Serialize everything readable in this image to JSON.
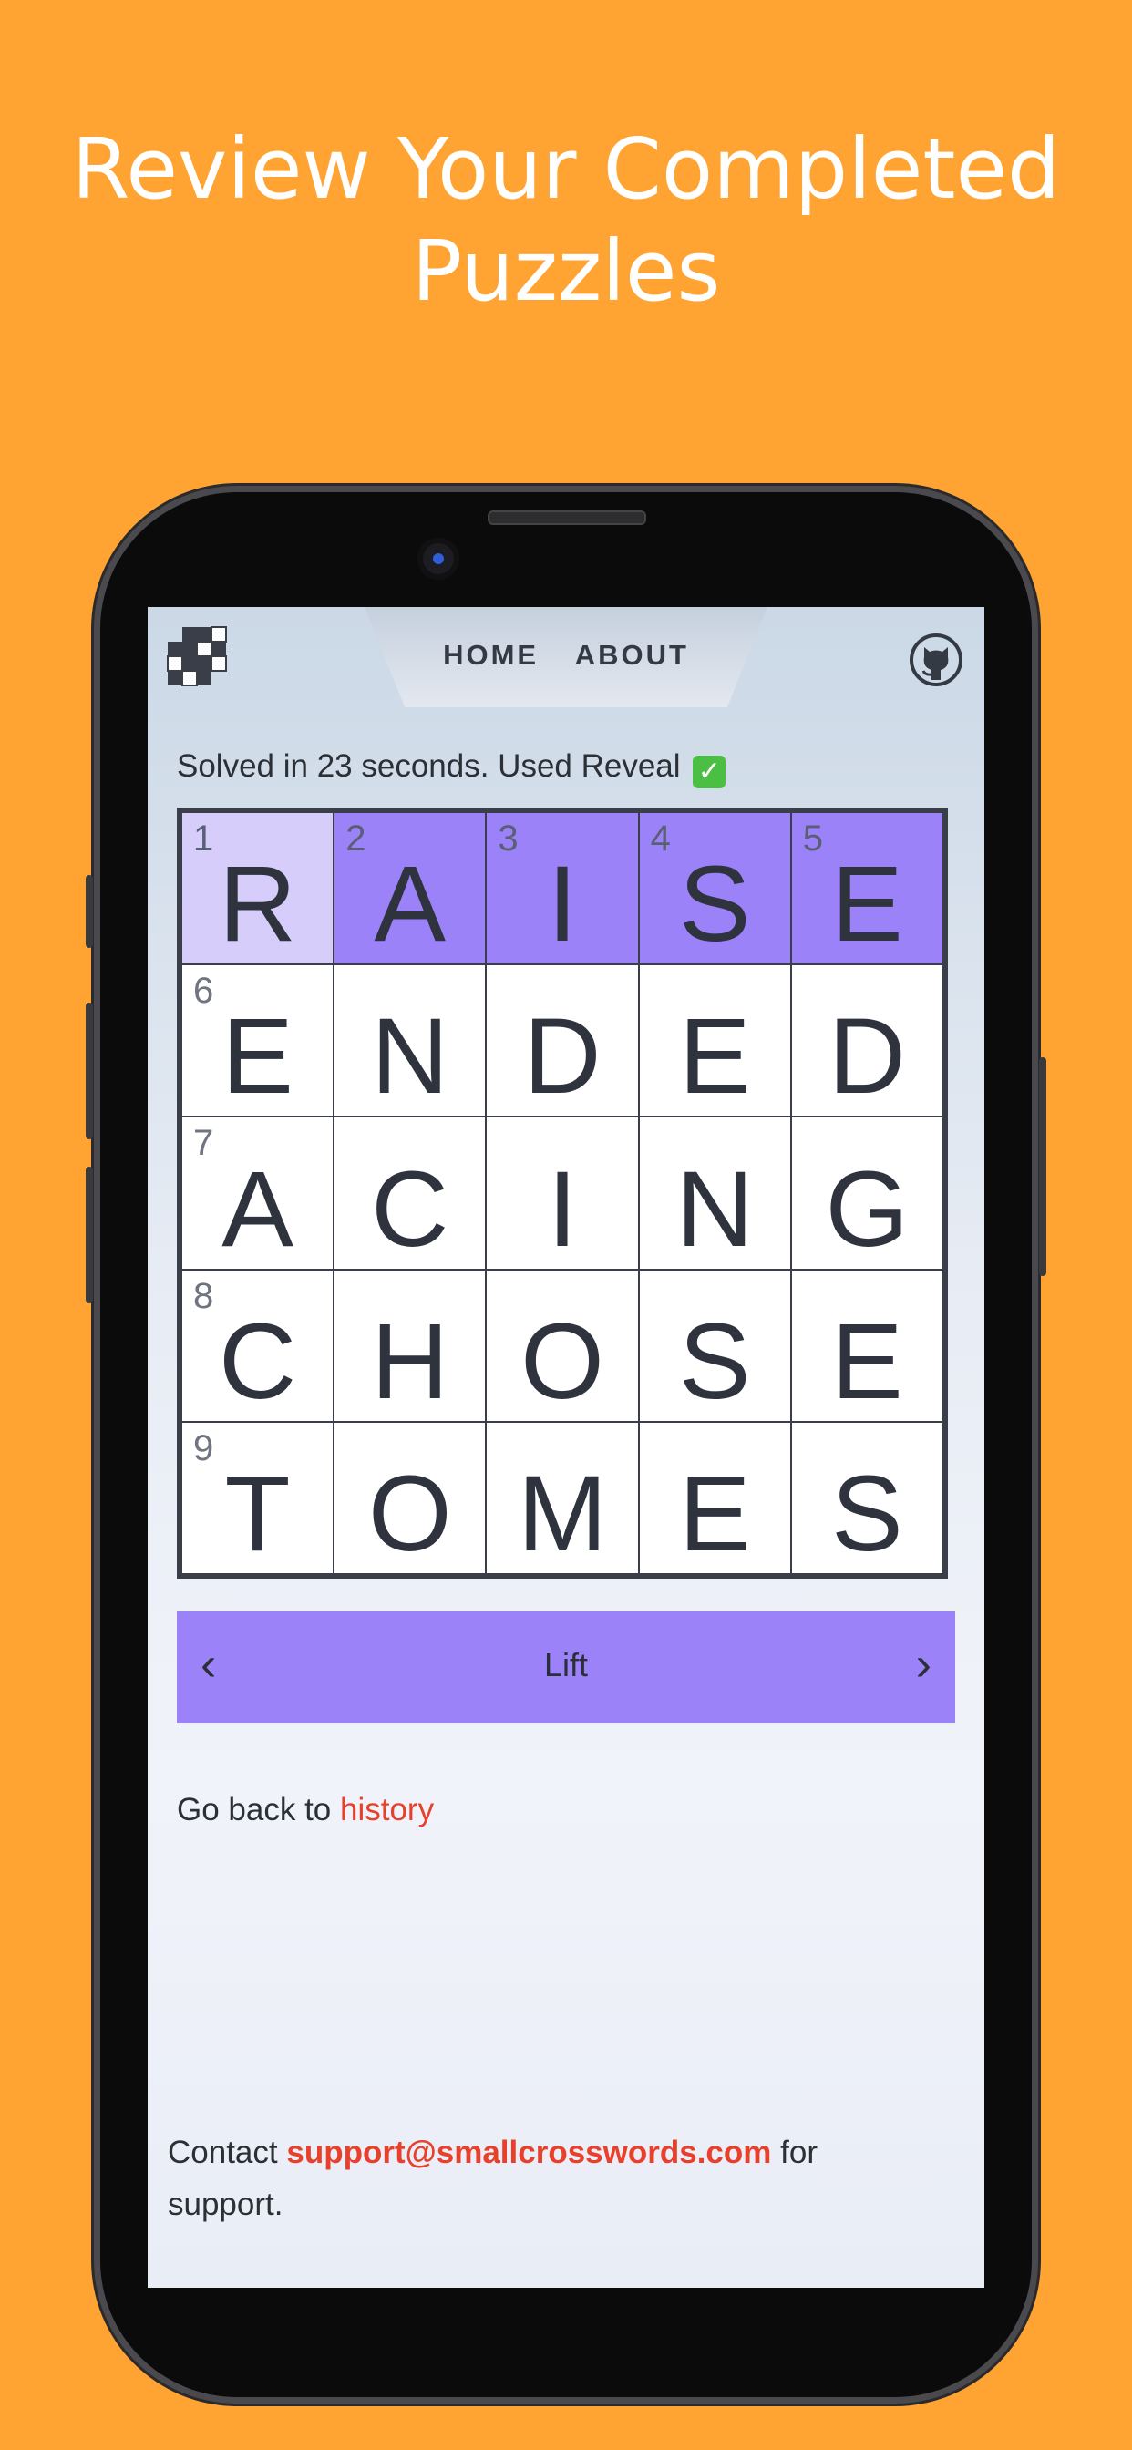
{
  "headline": {
    "line1": "Review Your Completed",
    "line2": "Puzzles"
  },
  "nav": {
    "home": "HOME",
    "about": "ABOUT"
  },
  "status": {
    "text": "Solved in 23 seconds. Used Reveal",
    "icon": "check-emoji-icon"
  },
  "grid": {
    "rows": [
      [
        {
          "num": "1",
          "letter": "R",
          "state": "focus"
        },
        {
          "num": "2",
          "letter": "A",
          "state": "active"
        },
        {
          "num": "3",
          "letter": "I",
          "state": "active"
        },
        {
          "num": "4",
          "letter": "S",
          "state": "active"
        },
        {
          "num": "5",
          "letter": "E",
          "state": "active"
        }
      ],
      [
        {
          "num": "6",
          "letter": "E"
        },
        {
          "num": "",
          "letter": "N"
        },
        {
          "num": "",
          "letter": "D"
        },
        {
          "num": "",
          "letter": "E"
        },
        {
          "num": "",
          "letter": "D"
        }
      ],
      [
        {
          "num": "7",
          "letter": "A"
        },
        {
          "num": "",
          "letter": "C"
        },
        {
          "num": "",
          "letter": "I"
        },
        {
          "num": "",
          "letter": "N"
        },
        {
          "num": "",
          "letter": "G"
        }
      ],
      [
        {
          "num": "8",
          "letter": "C"
        },
        {
          "num": "",
          "letter": "H"
        },
        {
          "num": "",
          "letter": "O"
        },
        {
          "num": "",
          "letter": "S"
        },
        {
          "num": "",
          "letter": "E"
        }
      ],
      [
        {
          "num": "9",
          "letter": "T"
        },
        {
          "num": "",
          "letter": "O"
        },
        {
          "num": "",
          "letter": "M"
        },
        {
          "num": "",
          "letter": "E"
        },
        {
          "num": "",
          "letter": "S"
        }
      ]
    ]
  },
  "clue": {
    "text": "Lift",
    "prev": "‹",
    "next": "›"
  },
  "footer": {
    "goback_text": "Go back to",
    "history_link": "history",
    "contact_prefix": "Contact",
    "email": "support@smallcrosswords.com",
    "contact_suffix": "for support."
  },
  "colors": {
    "background": "#FFA332",
    "highlight": "#9C82F8",
    "focus": "#D6CDFB",
    "link": "#E8402A"
  }
}
